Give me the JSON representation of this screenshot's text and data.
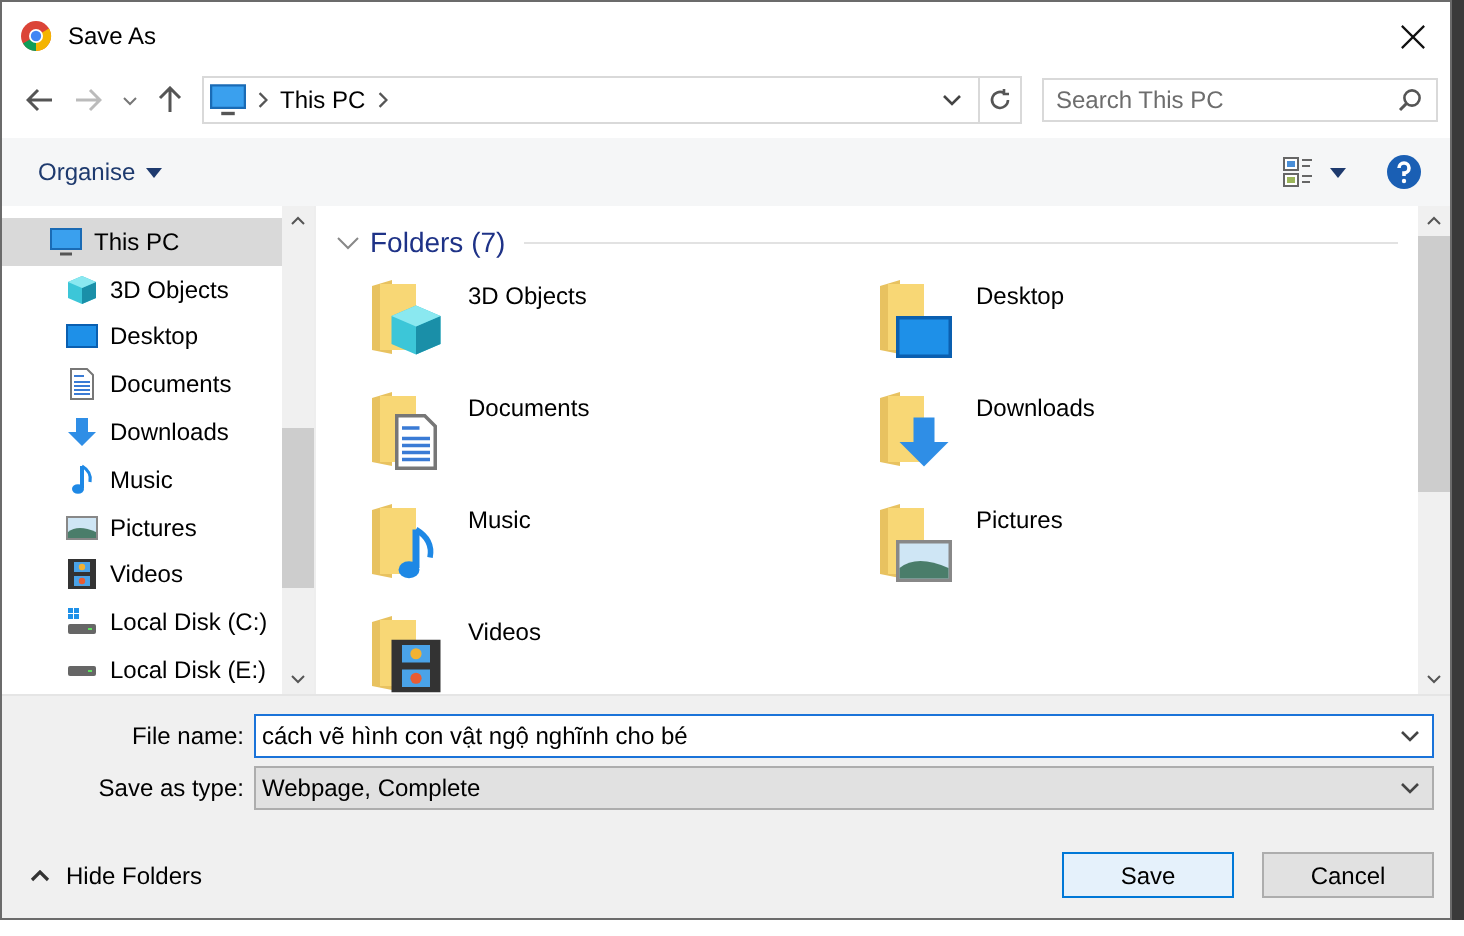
{
  "window": {
    "title": "Save As"
  },
  "address_bar": {
    "path": [
      "This PC"
    ],
    "search_placeholder": "Search This PC"
  },
  "toolbar": {
    "organise": "Organise"
  },
  "sidebar": {
    "items": [
      {
        "label": "This PC",
        "kind": "pc",
        "selected": true,
        "children": [
          {
            "label": "3D Objects",
            "kind": "objects",
            "selected": false
          },
          {
            "label": "Desktop",
            "kind": "desktop",
            "selected": false
          },
          {
            "label": "Documents",
            "kind": "documents",
            "selected": false
          },
          {
            "label": "Downloads",
            "kind": "downloads",
            "selected": false
          },
          {
            "label": "Music",
            "kind": "music",
            "selected": false
          },
          {
            "label": "Pictures",
            "kind": "pictures",
            "selected": false
          },
          {
            "label": "Videos",
            "kind": "videos",
            "selected": false
          },
          {
            "label": "Local Disk (C:)",
            "kind": "systemdisk",
            "selected": false
          },
          {
            "label": "Local Disk (E:)",
            "kind": "disk",
            "selected": false
          }
        ]
      }
    ]
  },
  "content": {
    "group": {
      "title": "Folders (7)",
      "expanded": true
    },
    "folders": [
      {
        "label": "3D Objects",
        "kind": "objects"
      },
      {
        "label": "Desktop",
        "kind": "desktop"
      },
      {
        "label": "Documents",
        "kind": "documents"
      },
      {
        "label": "Downloads",
        "kind": "downloads"
      },
      {
        "label": "Music",
        "kind": "music"
      },
      {
        "label": "Pictures",
        "kind": "pictures"
      },
      {
        "label": "Videos",
        "kind": "videos"
      }
    ]
  },
  "form": {
    "file_name_label": "File name:",
    "file_name": "cách vẽ hình con vật ngộ nghĩnh cho bé",
    "type_label": "Save as type:",
    "type": "Webpage, Complete"
  },
  "footer": {
    "hide_folders": "Hide Folders",
    "buttons": [
      {
        "label": "Save",
        "default": true
      },
      {
        "label": "Cancel",
        "default": false
      }
    ]
  }
}
